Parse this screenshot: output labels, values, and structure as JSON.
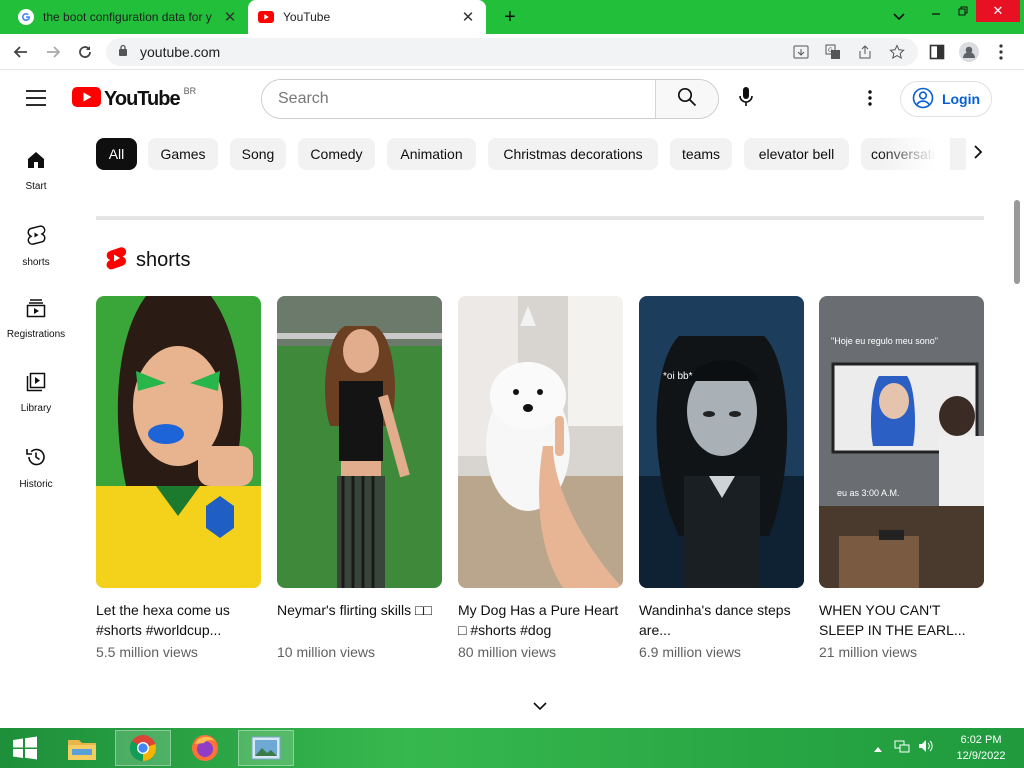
{
  "browser": {
    "tabs": [
      {
        "title": "the boot configuration data for y",
        "icon": "google-icon",
        "active": false
      },
      {
        "title": "YouTube",
        "icon": "youtube-icon",
        "active": true
      }
    ],
    "new_tab_symbol": "+",
    "url": "youtube.com",
    "window_controls": [
      "chevron-down-icon",
      "minimize-icon",
      "restore-icon",
      "close-icon"
    ],
    "accent_color": "#22c03a"
  },
  "youtube": {
    "logo_text": "YouTube",
    "country_code": "BR",
    "search": {
      "placeholder": "Search",
      "value": ""
    },
    "login_label": "Login",
    "brand_color": "#ff0000",
    "sidebar": [
      {
        "label": "Start",
        "icon": "home-icon"
      },
      {
        "label": "shorts",
        "icon": "shorts-icon"
      },
      {
        "label": "Registrations",
        "icon": "subscriptions-icon"
      },
      {
        "label": "Library",
        "icon": "library-icon"
      },
      {
        "label": "Historic",
        "icon": "history-icon"
      }
    ],
    "chips": [
      "All",
      "Games",
      "Song",
      "Comedy",
      "Animation",
      "Christmas decorations",
      "teams",
      "elevator bell",
      "conversati"
    ],
    "active_chip": "All",
    "shorts": {
      "heading": "shorts",
      "items": [
        {
          "title": "Let the hexa come us #shorts #worldcup...",
          "views": "5.5 million views"
        },
        {
          "title": "Neymar's flirting skills □□",
          "views": "10 million views"
        },
        {
          "title": "My Dog Has a Pure Heart □ #shorts #dog",
          "views": "80 million views"
        },
        {
          "title": "Wandinha's dance steps are...",
          "views": "6.9 million views"
        },
        {
          "title": "WHEN YOU CAN'T SLEEP IN THE EARL...",
          "views": "21 million views"
        }
      ],
      "overlay_texts": [
        "*oi bb*",
        "\"Hoje eu regulo meu sono\"",
        "eu as 3:00 A.M."
      ]
    }
  },
  "taskbar": {
    "apps": [
      "windows-start-icon",
      "file-explorer-icon",
      "chrome-icon",
      "firefox-icon",
      "photos-icon"
    ],
    "time": "6:02 PM",
    "date": "12/9/2022"
  }
}
